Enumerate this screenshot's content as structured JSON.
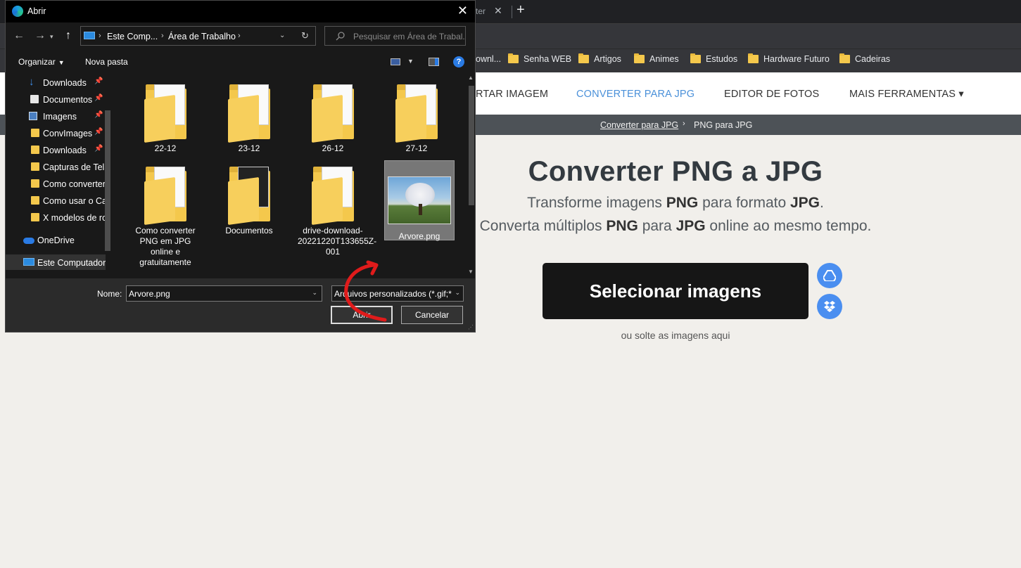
{
  "browser": {
    "tab_fragment": "ter",
    "tab_close_glyph": "✕",
    "new_tab_glyph": "+",
    "bookmarks": [
      {
        "label": "ownl...",
        "has_folder": false
      },
      {
        "label": "Senha WEB",
        "has_folder": true
      },
      {
        "label": "Artigos",
        "has_folder": true
      },
      {
        "label": "Animes",
        "has_folder": true
      },
      {
        "label": "Estudos",
        "has_folder": true
      },
      {
        "label": "Hardware Futuro",
        "has_folder": true
      },
      {
        "label": "Cadeiras",
        "has_folder": true
      }
    ]
  },
  "site": {
    "nav": {
      "item1": "RTAR IMAGEM",
      "item2": "CONVERTER PARA JPG",
      "item3": "EDITOR DE FOTOS",
      "item4": "MAIS FERRAMENTAS ▾"
    },
    "breadcrumb": {
      "parent": "Converter para JPG",
      "separator": "›",
      "current": "PNG para JPG"
    },
    "title": "Converter PNG a JPG",
    "subtitle1": {
      "pre": "Transforme imagens ",
      "b1": "PNG",
      "mid": " para formato ",
      "b2": "JPG",
      "post": "."
    },
    "subtitle2": {
      "pre": "Converta múltiplos ",
      "b1": "PNG",
      "mid": " para ",
      "b2": "JPG",
      "post": " online ao mesmo tempo."
    },
    "select_button": "Selecionar imagens",
    "drop_hint": "ou solte as imagens aqui",
    "accent_color": "#4a90d9",
    "cloud_icons": [
      "google-drive-icon",
      "dropbox-icon"
    ]
  },
  "dialog": {
    "title": "Abrir",
    "close_glyph": "✕",
    "path": [
      "Este Comp...",
      "Área de Trabalho"
    ],
    "search_placeholder": "Pesquisar em Área de Trabal...",
    "organize_label": "Organizar",
    "new_folder_label": "Nova pasta",
    "help_glyph": "?",
    "nav_items": [
      {
        "label": "Downloads",
        "icon": "download-icon",
        "pinned": true
      },
      {
        "label": "Documentos",
        "icon": "document-icon",
        "pinned": true
      },
      {
        "label": "Imagens",
        "icon": "images-icon",
        "pinned": true
      },
      {
        "label": "ConvImages",
        "icon": "folder-icon",
        "pinned": true
      },
      {
        "label": "Downloads",
        "icon": "folder-icon",
        "pinned": true
      },
      {
        "label": "Capturas de Tela",
        "icon": "folder-icon",
        "pinned": false
      },
      {
        "label": "Como converter",
        "icon": "folder-icon",
        "pinned": false
      },
      {
        "label": "Como usar o Ca",
        "icon": "folder-icon",
        "pinned": false
      },
      {
        "label": "X modelos de ro",
        "icon": "folder-icon",
        "pinned": false
      },
      {
        "label": "OneDrive",
        "icon": "onedrive-icon",
        "pinned": false
      },
      {
        "label": "Este Computador",
        "icon": "computer-icon",
        "pinned": false
      }
    ],
    "files": [
      {
        "name": "22-12",
        "kind": "folder"
      },
      {
        "name": "23-12",
        "kind": "folder"
      },
      {
        "name": "26-12",
        "kind": "folder"
      },
      {
        "name": "27-12",
        "kind": "folder"
      },
      {
        "name": "Como converter PNG em JPG online e gratuitamente",
        "kind": "folder"
      },
      {
        "name": "Documentos",
        "kind": "folder"
      },
      {
        "name": "drive-download-20221220T133655Z-001",
        "kind": "folder"
      },
      {
        "name": "Arvore.png",
        "kind": "image",
        "selected": true
      }
    ],
    "filename_label": "Nome:",
    "filename_value": "Arvore.png",
    "filetype_value": "Arquivos personalizados (*.gif;*",
    "open_button": "Abrir",
    "cancel_button": "Cancelar"
  }
}
